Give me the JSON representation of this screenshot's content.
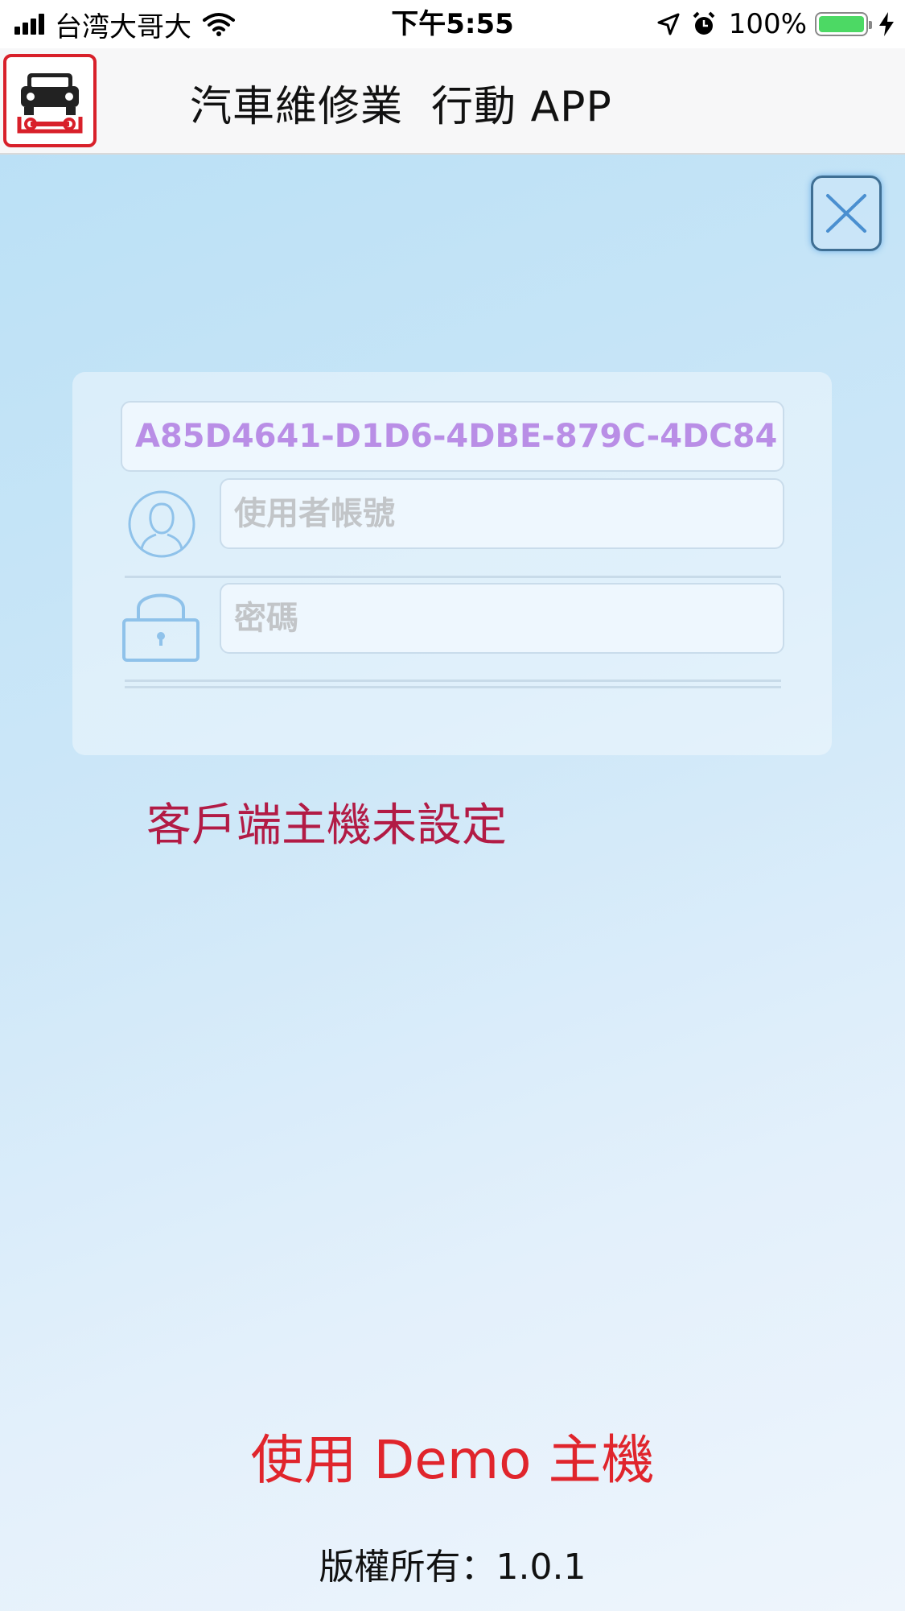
{
  "status_bar": {
    "carrier": "台湾大哥大",
    "time": "下午5:55",
    "battery_percent": "100%",
    "signal_bars": 4,
    "battery_level": 1.0
  },
  "header": {
    "title": "汽車維修業  行動 APP",
    "logo_icon": "car-repair-logo-icon",
    "accent_color": "#d8202a"
  },
  "login": {
    "device_id_value": "A85D4641-D1D6-4DBE-879C-4DC84",
    "username_placeholder": "使用者帳號",
    "password_placeholder": "密碼"
  },
  "error_message": "客戶端主機未設定",
  "demo_button_label": "使用 Demo 主機",
  "copyright": "版權所有：1.0.1",
  "colors": {
    "error": "#b21b45",
    "demo": "#e0252c",
    "device_id_text": "#b98ee6"
  }
}
